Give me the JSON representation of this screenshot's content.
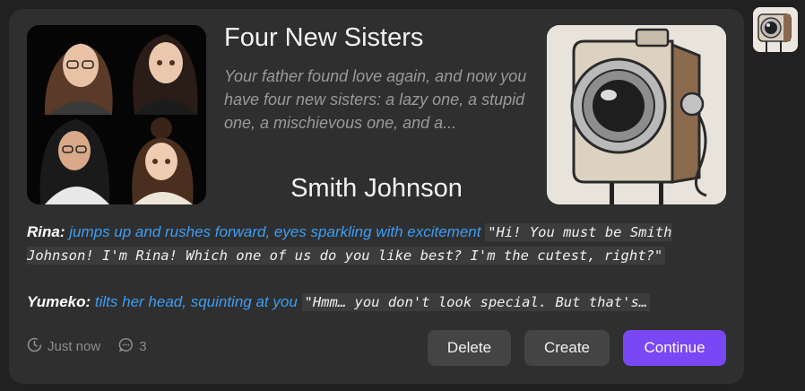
{
  "story": {
    "title": "Four New Sisters",
    "description": "Your father found love again, and now you have four new sisters: a lazy one, a stupid one, a mischievous one, and a...",
    "persona_name": "Smith Johnson"
  },
  "dialogue": [
    {
      "speaker": "Rina:",
      "action": "jumps up and rushes forward, eyes sparkling with excitement",
      "speech": "\"Hi! You must be Smith Johnson! I'm Rina! Which one of us do you like best? I'm the cutest, right?\""
    },
    {
      "speaker": "Yumeko:",
      "action": "tilts her head, squinting at you",
      "speech": "\"Hmm… you don't look special. But that's…"
    }
  ],
  "meta": {
    "time_label": "Just now",
    "comment_count": "3",
    "time_icon": "clock-icon",
    "comment_icon": "comment-icon"
  },
  "buttons": {
    "delete": "Delete",
    "create": "Create",
    "continue": "Continue"
  },
  "colors": {
    "background": "#212121",
    "card": "#2f2f2f",
    "action_text": "#3d9df3",
    "continue_button": "#7a47f5",
    "secondary_button": "#444444"
  }
}
